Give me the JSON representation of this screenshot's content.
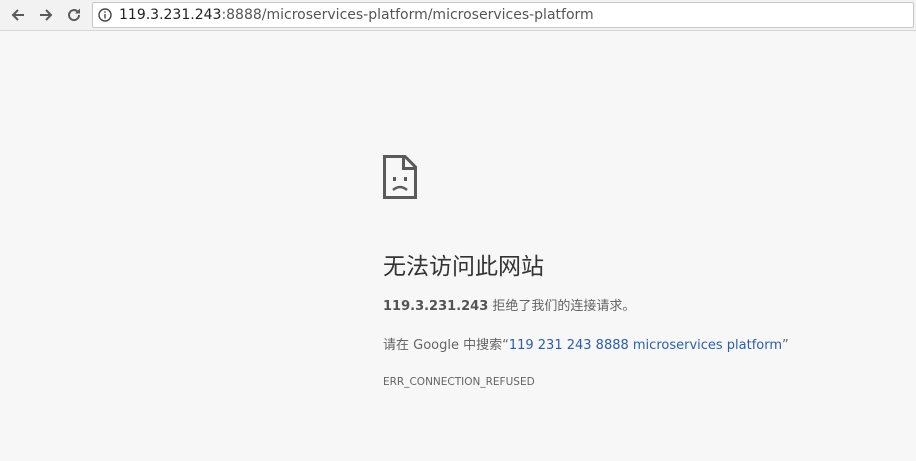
{
  "browser": {
    "back_icon": "arrow-left-icon",
    "forward_icon": "arrow-right-icon",
    "reload_icon": "reload-icon",
    "info_icon": "info-icon",
    "url_host": "119.3.231.243",
    "url_rest": ":8888/microservices-platform/microservices-platform"
  },
  "error": {
    "icon": "sad-document-icon",
    "title": "无法访问此网站",
    "host": "119.3.231.243",
    "refused_text": " 拒绝了我们的连接请求。",
    "suggest_prefix": "请在 Google 中搜索“",
    "suggest_link": "119 231 243 8888 microservices platform",
    "suggest_suffix": "”",
    "code": "ERR_CONNECTION_REFUSED"
  },
  "colors": {
    "background": "#f7f7f7",
    "link": "#2a5db0",
    "title": "#333333"
  }
}
